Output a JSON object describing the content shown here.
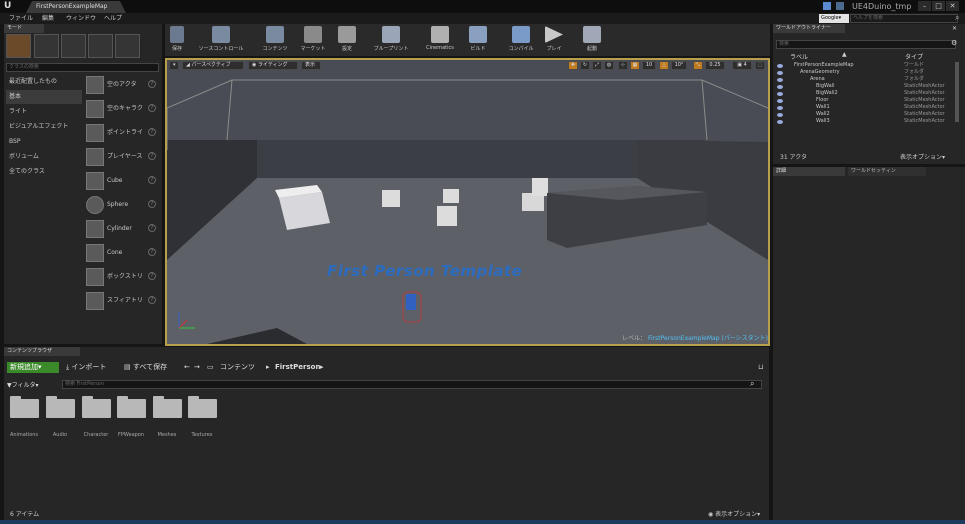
{
  "window": {
    "tab_title": "FirstPersonExampleMap",
    "project_name": "UE4Duino_tmp",
    "minimize": "–",
    "maximize": "□",
    "close": "✕"
  },
  "menu": [
    "ファイル",
    "編集",
    "ウィンドウ",
    "ヘルプ"
  ],
  "help": {
    "google": "Google▾",
    "placeholder": "ヘルプを検索"
  },
  "modes": {
    "tab": "モード",
    "search_placeholder": "クラスの検索",
    "categories": [
      "最近配置したもの",
      "基本",
      "ライト",
      "ビジュアルエフェクト",
      "BSP",
      "ボリューム",
      "全てのクラス"
    ],
    "selected_category": "基本",
    "items": [
      "空のアクタ",
      "空のキャラク",
      "ポイントライ",
      "プレイヤース",
      "Cube",
      "Sphere",
      "Cylinder",
      "Cone",
      "ボックストリ",
      "スフィアトリ"
    ]
  },
  "toolbar": [
    {
      "label": "保存",
      "icon": "save-icon"
    },
    {
      "label": "ソースコントロール",
      "icon": "source-control-icon"
    },
    {
      "label": "コンテンツ",
      "icon": "content-icon"
    },
    {
      "label": "マーケット",
      "icon": "marketplace-icon"
    },
    {
      "label": "設定",
      "icon": "settings-icon"
    },
    {
      "label": "ブループリント",
      "icon": "blueprint-icon"
    },
    {
      "label": "Cinematics",
      "icon": "cinematics-icon"
    },
    {
      "label": "ビルド",
      "icon": "build-icon"
    },
    {
      "label": "コンパイル",
      "icon": "compile-icon"
    },
    {
      "label": "プレイ",
      "icon": "play-icon"
    },
    {
      "label": "起動",
      "icon": "launch-icon"
    }
  ],
  "viewport": {
    "perspective": "パースペクティブ",
    "lighting": "ライティング",
    "show": "表示",
    "grid_snap": "10",
    "rot_snap": "10°",
    "scale_snap": "0.25",
    "camera_speed": "4",
    "scene_text": "First Person Template",
    "level_label": "レベル：",
    "level_name": "FirstPersonExampleMap (パーシスタント)"
  },
  "outliner": {
    "tab": "ワールドアウトライナー",
    "search_placeholder": "検索",
    "col_label": "ラベル",
    "col_type": "タイプ",
    "rows": [
      {
        "name": "FirstPersonExampleMap",
        "type": "ワールド"
      },
      {
        "name": "ArenaGeometry",
        "type": "フォルダ"
      },
      {
        "name": "Arena",
        "type": "フォルダ"
      },
      {
        "name": "BigWall",
        "type": "StaticMeshActor"
      },
      {
        "name": "BigWall2",
        "type": "StaticMeshActor"
      },
      {
        "name": "Floor",
        "type": "StaticMeshActor"
      },
      {
        "name": "Wall1",
        "type": "StaticMeshActor"
      },
      {
        "name": "Wall2",
        "type": "StaticMeshActor"
      },
      {
        "name": "Wall3",
        "type": "StaticMeshActor"
      }
    ],
    "actor_count": "31 アクタ",
    "view_options": "表示オプション▾"
  },
  "details": {
    "tab": "詳細",
    "world_settings_tab": "ワールドセッティン"
  },
  "content_browser": {
    "tab": "コンテンツブラウザ",
    "add_new": "新規追加▾",
    "import": "インポート",
    "save_all": "すべて保存",
    "path_root": "コンテンツ",
    "path_current": "FirstPerson",
    "filter": "フィルタ▾",
    "search_placeholder": "検索 FirstPerson",
    "folders": [
      "Animations",
      "Audio",
      "Character",
      "FPWeapon",
      "Meshes",
      "Textures"
    ],
    "item_count": "6 アイテム",
    "view_options": "表示オプション▾"
  }
}
